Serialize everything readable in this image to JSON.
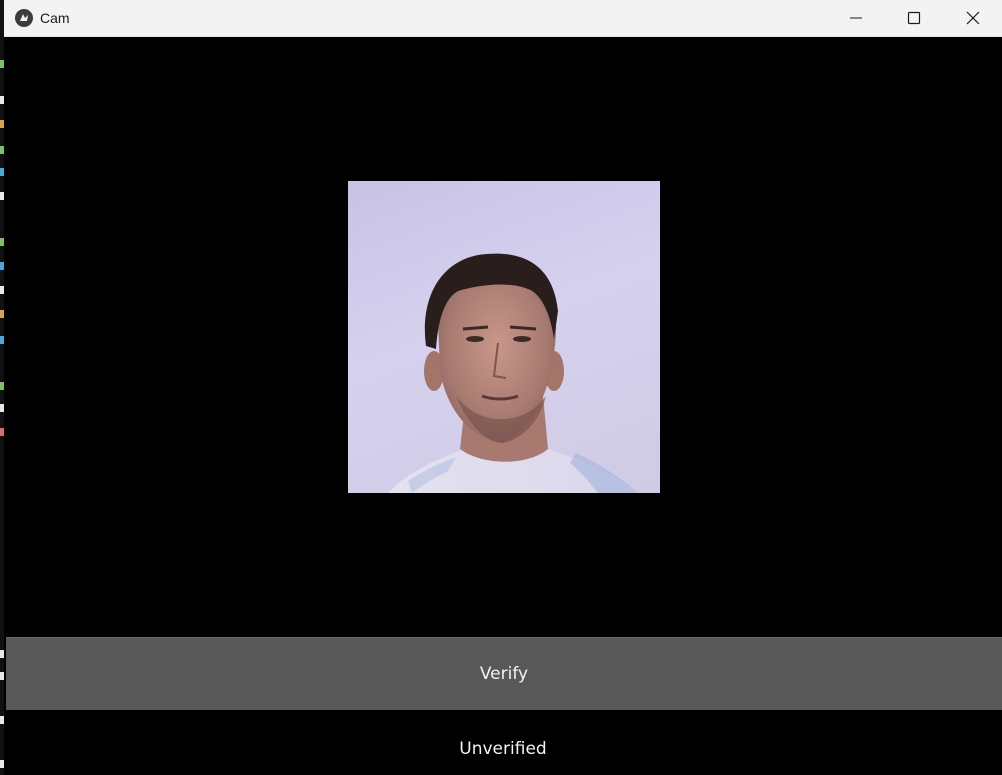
{
  "window": {
    "title": "Cam",
    "app_icon": "kivy-logo-icon",
    "controls": {
      "minimize_icon": "minimize-icon",
      "maximize_icon": "maximize-icon",
      "close_icon": "close-icon"
    }
  },
  "camera": {
    "description_icon": "webcam-image"
  },
  "actions": {
    "verify_label": "Verify"
  },
  "status": {
    "text": "Unverified"
  },
  "colors": {
    "background": "#000000",
    "titlebar": "#f3f3f3",
    "button": "#585858",
    "text": "#f2f2f2"
  }
}
